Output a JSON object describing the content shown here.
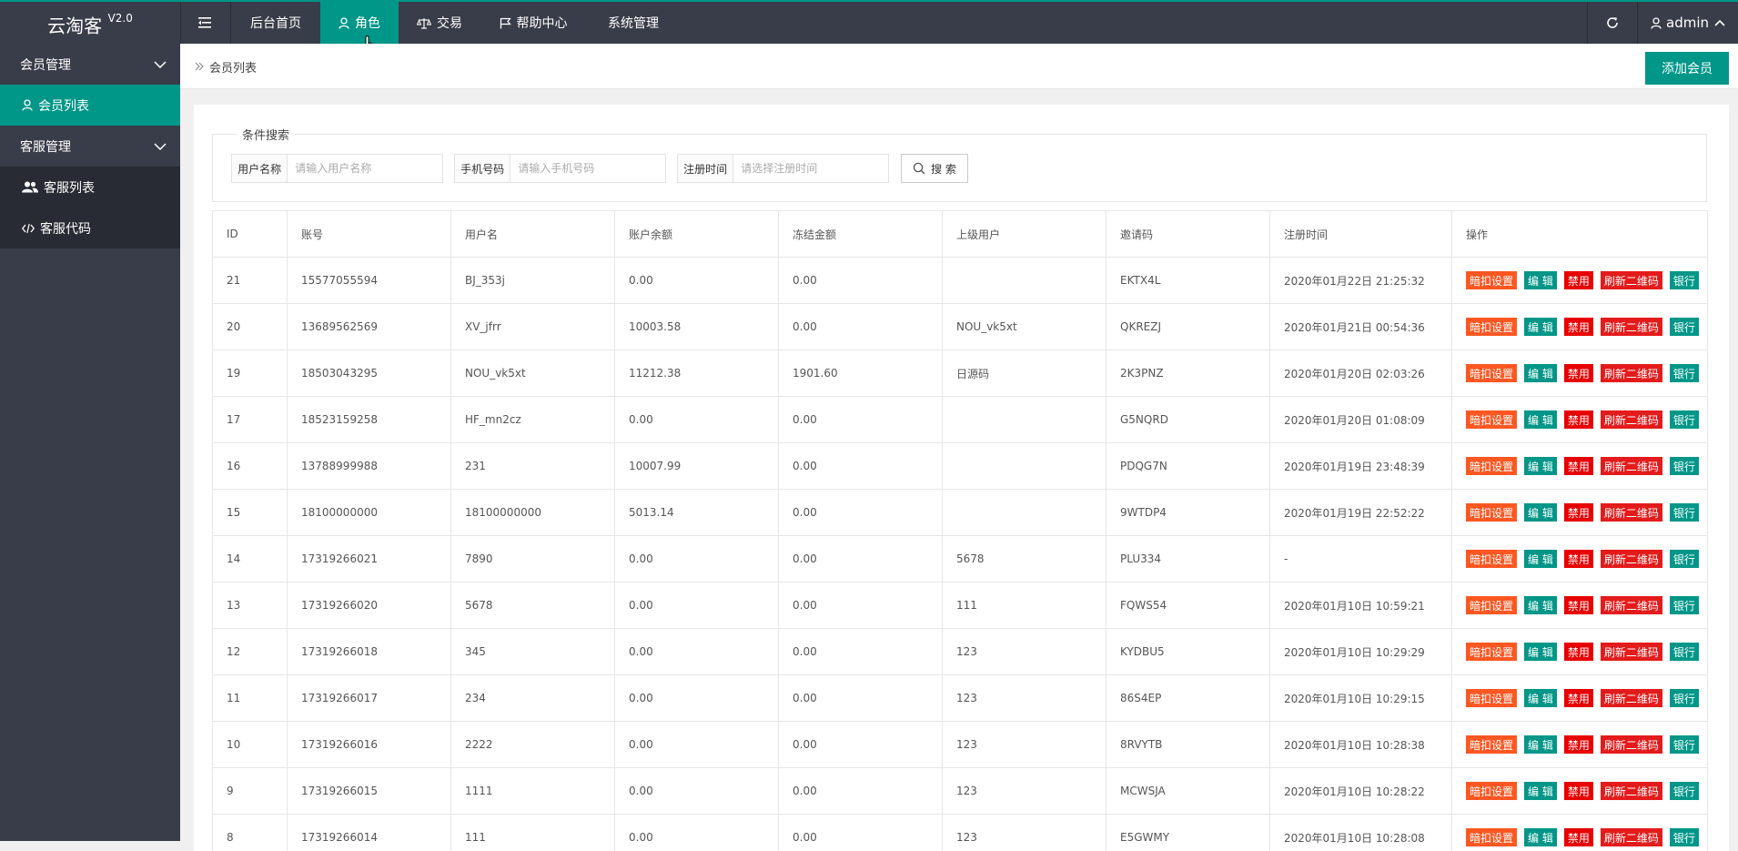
{
  "app": {
    "name": "云淘客",
    "version": "V2.0"
  },
  "nav": {
    "items": [
      {
        "label": "后台首页",
        "icon": "none"
      },
      {
        "label": "角色",
        "icon": "user-icon",
        "active": true
      },
      {
        "label": "交易",
        "icon": "scale-icon"
      },
      {
        "label": "帮助中心",
        "icon": "flag-icon"
      },
      {
        "label": "系统管理",
        "icon": "none"
      }
    ],
    "user": "admin"
  },
  "sidebar": {
    "groups": [
      {
        "label": "会员管理",
        "items": [
          {
            "label": "会员列表",
            "active": true
          }
        ]
      },
      {
        "label": "客服管理",
        "items": [
          {
            "label": "客服列表"
          },
          {
            "label": "客服代码"
          }
        ]
      }
    ]
  },
  "breadcrumb": {
    "current": "会员列表"
  },
  "actions": {
    "add_member": "添加会员"
  },
  "search": {
    "legend": "条件搜索",
    "username": {
      "label": "用户名称",
      "placeholder": "请输入用户名称"
    },
    "phone": {
      "label": "手机号码",
      "placeholder": "请输入手机号码"
    },
    "regtime": {
      "label": "注册时间",
      "placeholder": "请选择注册时间"
    },
    "button": "搜 索"
  },
  "table": {
    "headers": [
      "ID",
      "账号",
      "用户名",
      "账户余额",
      "冻结金额",
      "上级用户",
      "邀请码",
      "注册时间",
      "操作"
    ],
    "op_labels": [
      "暗扣设置",
      "编 辑",
      "禁用",
      "刷新二维码",
      "银行"
    ],
    "rows": [
      [
        "21",
        "15577055594",
        "BJ_353j",
        "0.00",
        "0.00",
        "",
        "EKTX4L",
        "2020年01月22日 21:25:32"
      ],
      [
        "20",
        "13689562569",
        "XV_jfrr",
        "10003.58",
        "0.00",
        "NOU_vk5xt",
        "QKREZJ",
        "2020年01月21日 00:54:36"
      ],
      [
        "19",
        "18503043295",
        "NOU_vk5xt",
        "11212.38",
        "1901.60",
        "日源码",
        "2K3PNZ",
        "2020年01月20日 02:03:26"
      ],
      [
        "17",
        "18523159258",
        "HF_mn2cz",
        "0.00",
        "0.00",
        "",
        "G5NQRD",
        "2020年01月20日 01:08:09"
      ],
      [
        "16",
        "13788999988",
        "231",
        "10007.99",
        "0.00",
        "",
        "PDQG7N",
        "2020年01月19日 23:48:39"
      ],
      [
        "15",
        "18100000000",
        "18100000000",
        "5013.14",
        "0.00",
        "",
        "9WTDP4",
        "2020年01月19日 22:52:22"
      ],
      [
        "14",
        "17319266021",
        "7890",
        "0.00",
        "0.00",
        "5678",
        "PLU334",
        "-"
      ],
      [
        "13",
        "17319266020",
        "5678",
        "0.00",
        "0.00",
        "111",
        "FQWS54",
        "2020年01月10日 10:59:21"
      ],
      [
        "12",
        "17319266018",
        "345",
        "0.00",
        "0.00",
        "123",
        "KYDBU5",
        "2020年01月10日 10:29:29"
      ],
      [
        "11",
        "17319266017",
        "234",
        "0.00",
        "0.00",
        "123",
        "86S4EP",
        "2020年01月10日 10:29:15"
      ],
      [
        "10",
        "17319266016",
        "2222",
        "0.00",
        "0.00",
        "123",
        "8RVYTB",
        "2020年01月10日 10:28:38"
      ],
      [
        "9",
        "17319266015",
        "1111",
        "0.00",
        "0.00",
        "123",
        "MCWSJA",
        "2020年01月10日 10:28:22"
      ],
      [
        "8",
        "17319266014",
        "111",
        "0.00",
        "0.00",
        "123",
        "E5GWMY",
        "2020年01月10日 10:28:08"
      ]
    ]
  },
  "colors": {
    "accent": "#009688",
    "header_bg": "#393D49",
    "sidebar_dark": "#282b33",
    "warn": "#FF5722",
    "danger": "#e80000"
  }
}
